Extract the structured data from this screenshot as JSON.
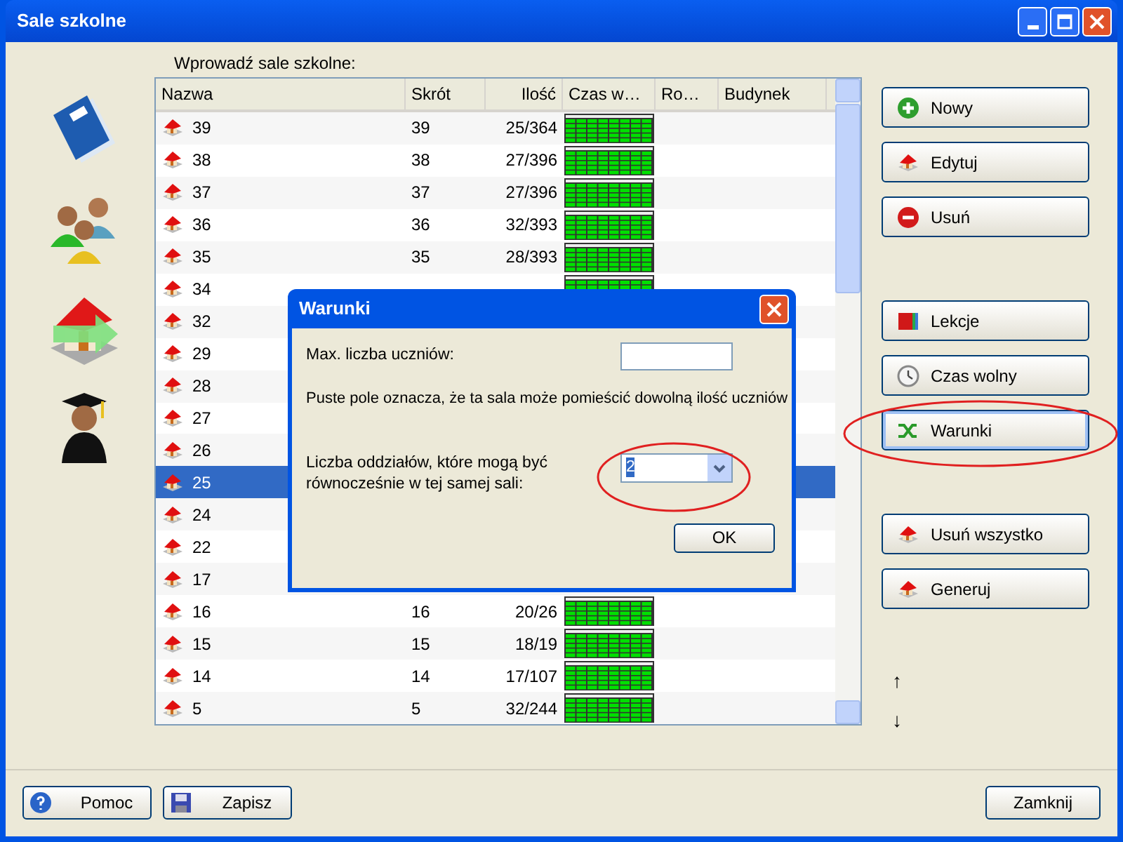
{
  "window": {
    "title": "Sale szkolne"
  },
  "list_label": "Wprowadź sale szkolne:",
  "table": {
    "columns": [
      "Nazwa",
      "Skrót",
      "Ilość",
      "Czas w…",
      "Ro…",
      "Budynek"
    ],
    "rows": [
      {
        "name": "39",
        "short": "39",
        "count": "25/364",
        "schedule": true,
        "selected": false
      },
      {
        "name": "38",
        "short": "38",
        "count": "27/396",
        "schedule": true,
        "selected": false
      },
      {
        "name": "37",
        "short": "37",
        "count": "27/396",
        "schedule": true,
        "selected": false
      },
      {
        "name": "36",
        "short": "36",
        "count": "32/393",
        "schedule": true,
        "selected": false
      },
      {
        "name": "35",
        "short": "35",
        "count": "28/393",
        "schedule": true,
        "selected": false
      },
      {
        "name": "34",
        "schedule": true,
        "selected": false
      },
      {
        "name": "32",
        "selected": false
      },
      {
        "name": "29",
        "selected": false
      },
      {
        "name": "28",
        "selected": false
      },
      {
        "name": "27",
        "selected": false
      },
      {
        "name": "26",
        "selected": false
      },
      {
        "name": "25",
        "selected": true
      },
      {
        "name": "24",
        "selected": false
      },
      {
        "name": "22",
        "selected": false
      },
      {
        "name": "17",
        "selected": false
      },
      {
        "name": "16",
        "short": "16",
        "count": "20/26",
        "schedule": true,
        "selected": false
      },
      {
        "name": "15",
        "short": "15",
        "count": "18/19",
        "schedule": true,
        "selected": false
      },
      {
        "name": "14",
        "short": "14",
        "count": "17/107",
        "schedule": true,
        "selected": false
      },
      {
        "name": "5",
        "short": "5",
        "count": "32/244",
        "schedule": true,
        "selected": false
      }
    ]
  },
  "side_buttons": [
    {
      "label": "Nowy",
      "kind": "add",
      "highlighted": false,
      "gap_before": false
    },
    {
      "label": "Edytuj",
      "kind": "edit",
      "highlighted": false,
      "gap_before": false
    },
    {
      "label": "Usuń",
      "kind": "remove",
      "highlighted": false,
      "gap_before": false
    },
    {
      "label": "Lekcje",
      "kind": "lessons",
      "highlighted": false,
      "gap_before": true
    },
    {
      "label": "Czas wolny",
      "kind": "time",
      "highlighted": false,
      "gap_before": false
    },
    {
      "label": "Warunki",
      "kind": "conditions",
      "highlighted": true,
      "gap_before": false
    },
    {
      "label": "Usuń wszystko",
      "kind": "clear",
      "highlighted": false,
      "gap_before": true
    },
    {
      "label": "Generuj",
      "kind": "generate",
      "highlighted": false,
      "gap_before": false
    }
  ],
  "move_buttons": [
    "↑",
    "↓"
  ],
  "footer_buttons": [
    {
      "label": "Pomoc",
      "kind": "help"
    },
    {
      "label": "Zapisz",
      "kind": "save"
    }
  ],
  "close_button": "Zamknij",
  "dialog": {
    "title": "Warunki",
    "max_label": "Max. liczba uczniów:",
    "hint": "Puste pole oznacza, że ta sala może pomieścić dowolną ilość uczniów",
    "classes_label": "Liczba oddziałów, które mogą być równocześnie w tej samej sali:",
    "classes_value": "2",
    "ok": "OK"
  }
}
